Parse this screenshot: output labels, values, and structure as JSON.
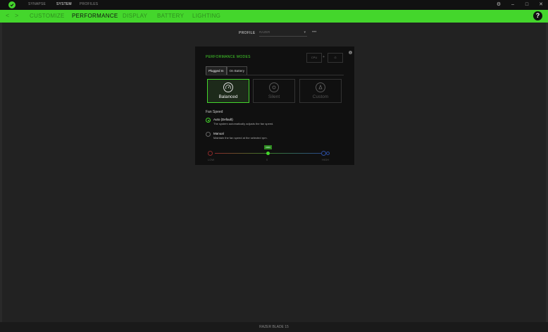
{
  "topbar": {
    "tabs": [
      "SYNAPSE",
      "SYSTEM",
      "PROFILES"
    ],
    "active_tab": 1
  },
  "nav": {
    "back": "<",
    "forward": ">",
    "tabs": [
      "CUSTOMIZE",
      "PERFORMANCE",
      "DISPLAY",
      "BATTERY",
      "LIGHTING"
    ],
    "help": "?"
  },
  "profile": {
    "label": "PROFILE",
    "value": "RAZER",
    "more": "•••"
  },
  "panel": {
    "title": "PERFORMANCE MODES",
    "info": "i",
    "cpu_value": "CPU",
    "gpu_value": "G",
    "plus": "+",
    "tabs": [
      "Plugged In",
      "On Battery"
    ],
    "modes": [
      "Balanced",
      "Silent",
      "Custom"
    ],
    "fan": {
      "title": "Fan Speed",
      "auto_title": "Auto (Default)",
      "auto_desc": "The system automatically adjusts the fan speed.",
      "manual_title": "Manual",
      "manual_desc": "Maintain the fan speed at the selected rpm.",
      "tip": "0000",
      "low": "LOW",
      "mid": "0",
      "high": "HIGH"
    }
  },
  "status": {
    "device": "RAZER BLADE 15"
  },
  "colors": {
    "accent": "#44d62c"
  }
}
